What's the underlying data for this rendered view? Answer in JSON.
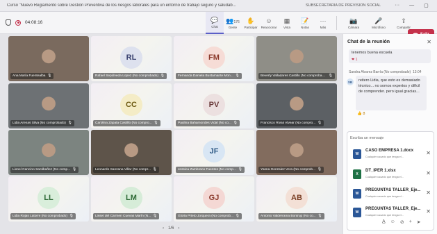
{
  "window": {
    "title": "Curso \"Nuevo Reglamento sobre Gestión Preventiva de los riesgos laborales para un entorno de trabajo seguro y saludab...",
    "tenant": "SUBSECRETARIA DE PREVISION SOCIAL",
    "controls": [
      "···",
      "—",
      "▢",
      "✕"
    ]
  },
  "meeting": {
    "timer": "04:08:16"
  },
  "toolbar": {
    "actions": [
      {
        "label": "Chat",
        "icon": "chat-icon",
        "glyph": "💬",
        "active": true
      },
      {
        "label": "Gente",
        "icon": "people-icon",
        "glyph": "👥",
        "count": "176"
      },
      {
        "label": "Participar",
        "icon": "raise-hand-icon",
        "glyph": "✋"
      },
      {
        "label": "Reaccionar",
        "icon": "reaction-icon",
        "glyph": "☺"
      },
      {
        "label": "Vista",
        "icon": "view-icon",
        "glyph": "▦"
      },
      {
        "label": "Notas",
        "icon": "notes-icon",
        "glyph": "📝"
      },
      {
        "label": "Más",
        "icon": "more-icon",
        "glyph": "···"
      }
    ],
    "devices": [
      {
        "label": "Cámara",
        "icon": "camera-icon",
        "glyph": "📷"
      },
      {
        "label": "Micrófono",
        "icon": "microphone-icon",
        "glyph": "🎤"
      },
      {
        "label": "Compartir",
        "icon": "share-icon",
        "glyph": "⇪"
      }
    ],
    "leave_label": "Salir"
  },
  "tiles": [
    {
      "name": "Ana María Fuentealba",
      "video": true,
      "bg": "#7a6a5e"
    },
    {
      "name": "Rafael Sepúlveda Lopez (No comprobado)",
      "initials": "RL",
      "avatar_bg": "#dde1ee",
      "avatar_fg": "#3a4270"
    },
    {
      "name": "Fernanda Daniela Bustamante Mon...",
      "initials": "FM",
      "avatar_bg": "#f6dcd6",
      "avatar_fg": "#8b3a2c"
    },
    {
      "name": "Beverly Valladares Castillo (No comprobado)",
      "video": true,
      "bg": "#8f8e87"
    },
    {
      "name": "Lidia Arenas Silva (No comprobado)",
      "video": true,
      "bg": "#6d7174"
    },
    {
      "name": "Carolina Zapata Castillo (No compro...",
      "initials": "CC",
      "avatar_bg": "#f4ecc6",
      "avatar_fg": "#6e5a12"
    },
    {
      "name": "Paulina Bahamondes Vidal (No co...",
      "initials": "PV",
      "avatar_bg": "#ece0e0",
      "avatar_fg": "#6a3a3a"
    },
    {
      "name": "Francisco Rivas Alvear (No compro...",
      "video": true,
      "bg": "#5c6064"
    },
    {
      "name": "Lionel Cancino Santibañez (No comp...",
      "video": true,
      "bg": "#7c8480"
    },
    {
      "name": "Leonardo Sanzana Villar (No compr...",
      "video": true,
      "bg": "#5e544a"
    },
    {
      "name": "Jessica Zambrano Fuentes (No comp...",
      "initials": "JF",
      "avatar_bg": "#d8e6f4",
      "avatar_fg": "#2e5a86"
    },
    {
      "name": "Yasna Gonzalez Vera (No comprob...",
      "video": true,
      "bg": "#826c5e"
    },
    {
      "name": "Lidia Rojas Latorre (No comprobado)",
      "initials": "LL",
      "avatar_bg": "#d9eedb",
      "avatar_fg": "#2e6a36"
    },
    {
      "name": "Lisset del Carmen Cuevas Marín (N...",
      "initials": "LM",
      "avatar_bg": "#d6ecd8",
      "avatar_fg": "#2e6a36"
    },
    {
      "name": "Gloria Prieto Jorquera (No comprob...",
      "initials": "GJ",
      "avatar_bg": "#f4d8d4",
      "avatar_fg": "#8b3a2c"
    },
    {
      "name": "Antonio Valderrama Bontrup (No co...",
      "initials": "AB",
      "avatar_bg": "#f3e0d6",
      "avatar_fg": "#7a3f24"
    }
  ],
  "pager": {
    "prev": "‹",
    "label": "1/6",
    "next": "›"
  },
  "chat": {
    "header": "Chat de la reunión",
    "prev_message": {
      "text": "tenemos buena escuela",
      "reaction": "❤ 1"
    },
    "message": {
      "author": "Sandra Alvarez Barría (No comprobado)",
      "time": "13:04",
      "initials": "SB",
      "text": "reitero Lidia, que esto es demasiado técnico... no somos expertos y difícil de comprender. pero igual gracias...",
      "reaction": "👍 8"
    },
    "compose": {
      "placeholder": "Escriba un mensaje",
      "attachments": [
        {
          "name": "CASO EMPRESA 1.docx",
          "sub": "Cualquier usuario que tenga el...",
          "type": "W",
          "color": "#2b5797"
        },
        {
          "name": "DT_IPER 1.xlsx",
          "sub": "Cualquier usuario que tenga el...",
          "type": "X",
          "color": "#1e7145"
        },
        {
          "name": "PREGUNTAS TALLER_Eje...",
          "sub": "Cualquier usuario que tenga el...",
          "type": "W",
          "color": "#2b5797"
        },
        {
          "name": "PREGUNTAS TALLER_Eje...",
          "sub": "Cualquier usuario que tenga el...",
          "type": "W",
          "color": "#2b5797"
        }
      ],
      "icons": [
        "format-icon",
        "emoji-icon",
        "attach-icon",
        "add-icon",
        "send-icon"
      ]
    }
  }
}
